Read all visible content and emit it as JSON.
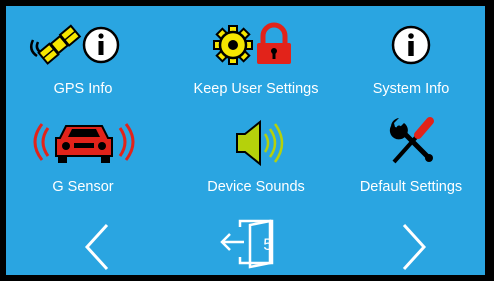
{
  "menu": {
    "items": [
      {
        "label": "GPS Info",
        "icon": "satellite-info-icon"
      },
      {
        "label": "Keep User Settings",
        "icon": "gear-lock-icon"
      },
      {
        "label": "System Info",
        "icon": "info-icon"
      },
      {
        "label": "G Sensor",
        "icon": "car-vibration-icon"
      },
      {
        "label": "Device Sounds",
        "icon": "speaker-icon"
      },
      {
        "label": "Default Settings",
        "icon": "wrench-screwdriver-icon"
      }
    ]
  },
  "nav": {
    "prev_icon": "chevron-left-icon",
    "next_icon": "chevron-right-icon",
    "exit_icon": "exit-door-icon",
    "exit_count": "5"
  },
  "colors": {
    "background": "#2aa5e1",
    "icon_yellow": "#f6e600",
    "icon_red": "#e2231a",
    "icon_green": "#b5d10b",
    "icon_black": "#000000",
    "text": "#ffffff"
  }
}
